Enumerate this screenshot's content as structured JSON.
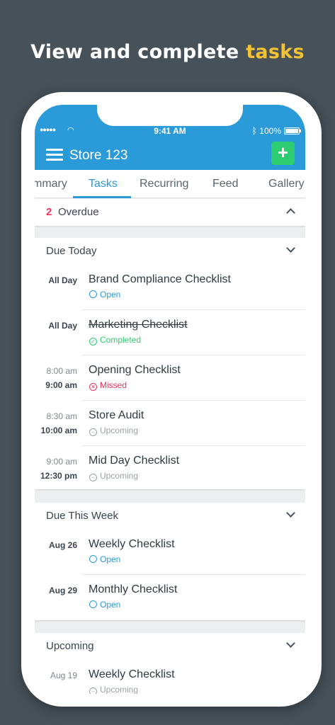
{
  "headline": {
    "prefix": "View and complete ",
    "accent": "tasks"
  },
  "status_bar": {
    "time": "9:41 AM",
    "battery": "100%"
  },
  "app": {
    "title": "Store 123",
    "add_label": "+"
  },
  "tabs": [
    {
      "label": "mmary",
      "active": false
    },
    {
      "label": "Tasks",
      "active": true
    },
    {
      "label": "Recurring",
      "active": false
    },
    {
      "label": "Feed",
      "active": false
    },
    {
      "label": "Gallery",
      "active": false
    }
  ],
  "overdue": {
    "count": "2",
    "label": "Overdue"
  },
  "sections": {
    "due_today": {
      "title": "Due Today",
      "rows": [
        {
          "time1": "All Day",
          "time2": "",
          "name": "Brand Compliance Checklist",
          "status": "Open"
        },
        {
          "time1": "All Day",
          "time2": "",
          "name": "Marketing Checklist",
          "status": "Completed"
        },
        {
          "time1": "8:00 am",
          "time2": "9:00 am",
          "name": "Opening Checklist",
          "status": "Missed"
        },
        {
          "time1": "8:30 am",
          "time2": "10:00 am",
          "name": "Store Audit",
          "status": "Upcoming"
        },
        {
          "time1": "9:00 am",
          "time2": "12:30 pm",
          "name": "Mid Day Checklist",
          "status": "Upcoming"
        }
      ]
    },
    "due_this_week": {
      "title": "Due This Week",
      "rows": [
        {
          "time1": "Aug 26",
          "name": "Weekly Checklist",
          "status": "Open"
        },
        {
          "time1": "Aug 29",
          "name": "Monthly Checklist",
          "status": "Open"
        }
      ]
    },
    "upcoming": {
      "title": "Upcoming",
      "rows": [
        {
          "time1": "Aug 19",
          "name": "Weekly Checklist",
          "status": "Upcoming"
        }
      ]
    }
  },
  "colors": {
    "primary": "#2b9ad9",
    "accent": "#f5c233",
    "add": "#2ecc71",
    "overdue": "#e8365b",
    "background": "#46515a"
  }
}
